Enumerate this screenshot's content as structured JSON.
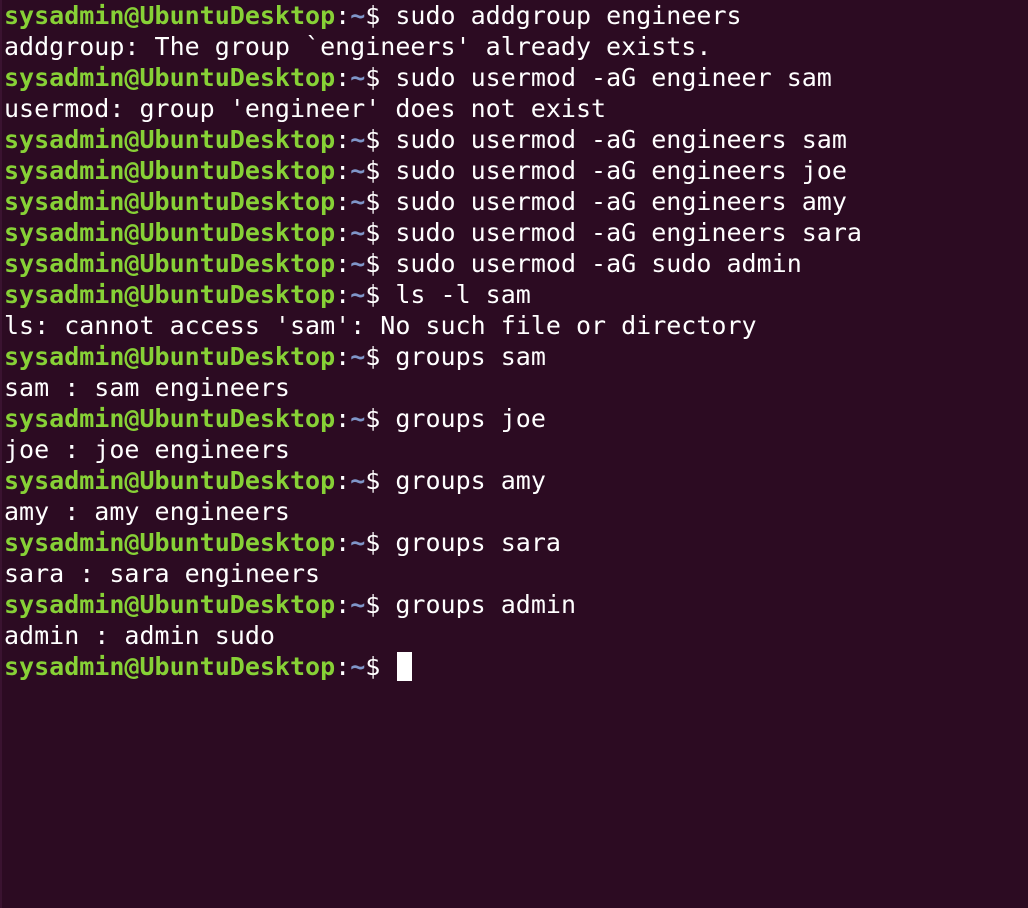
{
  "terminal": {
    "prompt": {
      "user_host": "sysadmin@UbuntuDesktop",
      "separator": ":",
      "path": "~",
      "symbol": "$ "
    },
    "lines": [
      {
        "type": "cmd",
        "text": "sudo addgroup engineers"
      },
      {
        "type": "out",
        "text": "addgroup: The group `engineers' already exists."
      },
      {
        "type": "cmd",
        "text": "sudo usermod -aG engineer sam"
      },
      {
        "type": "out",
        "text": "usermod: group 'engineer' does not exist"
      },
      {
        "type": "cmd",
        "text": "sudo usermod -aG engineers sam"
      },
      {
        "type": "cmd",
        "text": "sudo usermod -aG engineers joe"
      },
      {
        "type": "cmd",
        "text": "sudo usermod -aG engineers amy"
      },
      {
        "type": "cmd",
        "text": "sudo usermod -aG engineers sara"
      },
      {
        "type": "cmd",
        "text": "sudo usermod -aG sudo admin"
      },
      {
        "type": "cmd",
        "text": "ls -l sam"
      },
      {
        "type": "out",
        "text": "ls: cannot access 'sam': No such file or directory"
      },
      {
        "type": "cmd",
        "text": "groups sam"
      },
      {
        "type": "out",
        "text": "sam : sam engineers"
      },
      {
        "type": "cmd",
        "text": "groups joe"
      },
      {
        "type": "out",
        "text": "joe : joe engineers"
      },
      {
        "type": "cmd",
        "text": "groups amy"
      },
      {
        "type": "out",
        "text": "amy : amy engineers"
      },
      {
        "type": "cmd",
        "text": "groups sara"
      },
      {
        "type": "out",
        "text": "sara : sara engineers"
      },
      {
        "type": "cmd",
        "text": "groups admin"
      },
      {
        "type": "out",
        "text": "admin : admin sudo"
      },
      {
        "type": "prompt",
        "text": ""
      }
    ],
    "colors": {
      "background": "#2c0b22",
      "user_host": "#87d136",
      "path": "#7f96c9",
      "text": "#ffffff"
    }
  }
}
